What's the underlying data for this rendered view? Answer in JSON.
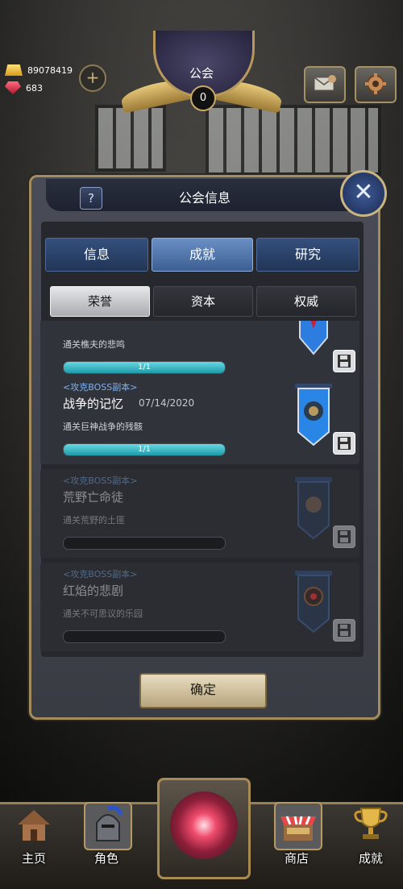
{
  "resources": {
    "gold": "89078419",
    "gems": "683"
  },
  "guild": {
    "title": "公会",
    "count": "0"
  },
  "panel": {
    "help": "?",
    "title": "公会信息",
    "close": "✕"
  },
  "tabs": [
    {
      "label": "信息",
      "selected": false
    },
    {
      "label": "成就",
      "selected": true
    },
    {
      "label": "研究",
      "selected": false
    }
  ],
  "subtabs": [
    {
      "label": "荣誉",
      "selected": true
    },
    {
      "label": "资本",
      "selected": false
    },
    {
      "label": "权威",
      "selected": false
    }
  ],
  "achievements": [
    {
      "tag": "",
      "name": "",
      "date": "",
      "desc": "通关樵夫的悲鸣",
      "progress_text": "1/1",
      "progress": 1.0,
      "completed": true
    },
    {
      "tag": "<攻克BOSS副本>",
      "name": "战争的记忆",
      "date": "07/14/2020",
      "desc": "通关巨神战争的残骸",
      "progress_text": "1/1",
      "progress": 1.0,
      "completed": true
    },
    {
      "tag": "<攻克BOSS副本>",
      "name": "荒野亡命徒",
      "date": "",
      "desc": "通关荒野的土匪",
      "progress_text": "",
      "progress": 0,
      "completed": false
    },
    {
      "tag": "<攻克BOSS副本>",
      "name": "红焰的悲剧",
      "date": "",
      "desc": "通关不可思议的乐园",
      "progress_text": "",
      "progress": 0,
      "completed": false
    }
  ],
  "confirm_label": "确定",
  "nav": {
    "home": "主页",
    "character": "角色",
    "shop": "商店",
    "achievements": "成就"
  },
  "colors": {
    "tab_selected": "#6a8fc4",
    "progress": "#2bb3c2",
    "frame": "#a58c5e"
  }
}
